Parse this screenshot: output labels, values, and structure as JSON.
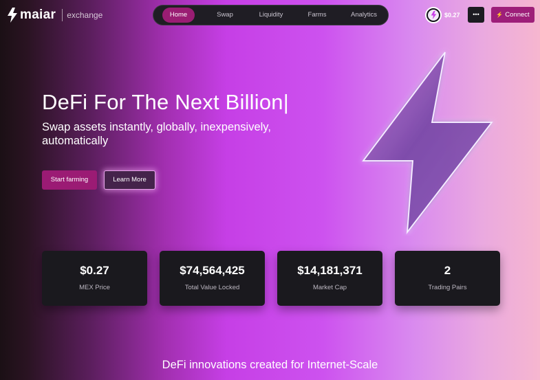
{
  "brand": {
    "name": "maiar",
    "sub": "exchange"
  },
  "nav": {
    "items": [
      {
        "label": "Home",
        "active": true
      },
      {
        "label": "Swap",
        "active": false
      },
      {
        "label": "Liquidity",
        "active": false
      },
      {
        "label": "Farms",
        "active": false
      },
      {
        "label": "Analytics",
        "active": false
      }
    ]
  },
  "header": {
    "price": "$0.27",
    "more_label": "•••",
    "connect_label": "Connect"
  },
  "hero": {
    "title": "DeFi For The Next Billion|",
    "subtitle": "Swap assets instantly, globally, inexpensively, automatically",
    "primary_button": "Start farming",
    "secondary_button": "Learn More"
  },
  "stats": [
    {
      "value": "$0.27",
      "label": "MEX Price"
    },
    {
      "value": "$74,564,425",
      "label": "Total Value Locked"
    },
    {
      "value": "$14,181,371",
      "label": "Market Cap"
    },
    {
      "value": "2",
      "label": "Trading Pairs"
    }
  ],
  "tagline": "DeFi innovations created for Internet-Scale",
  "colors": {
    "accent": "#9b1b74",
    "dark_panel": "#1a191e",
    "highlight": "#c83fe8"
  }
}
